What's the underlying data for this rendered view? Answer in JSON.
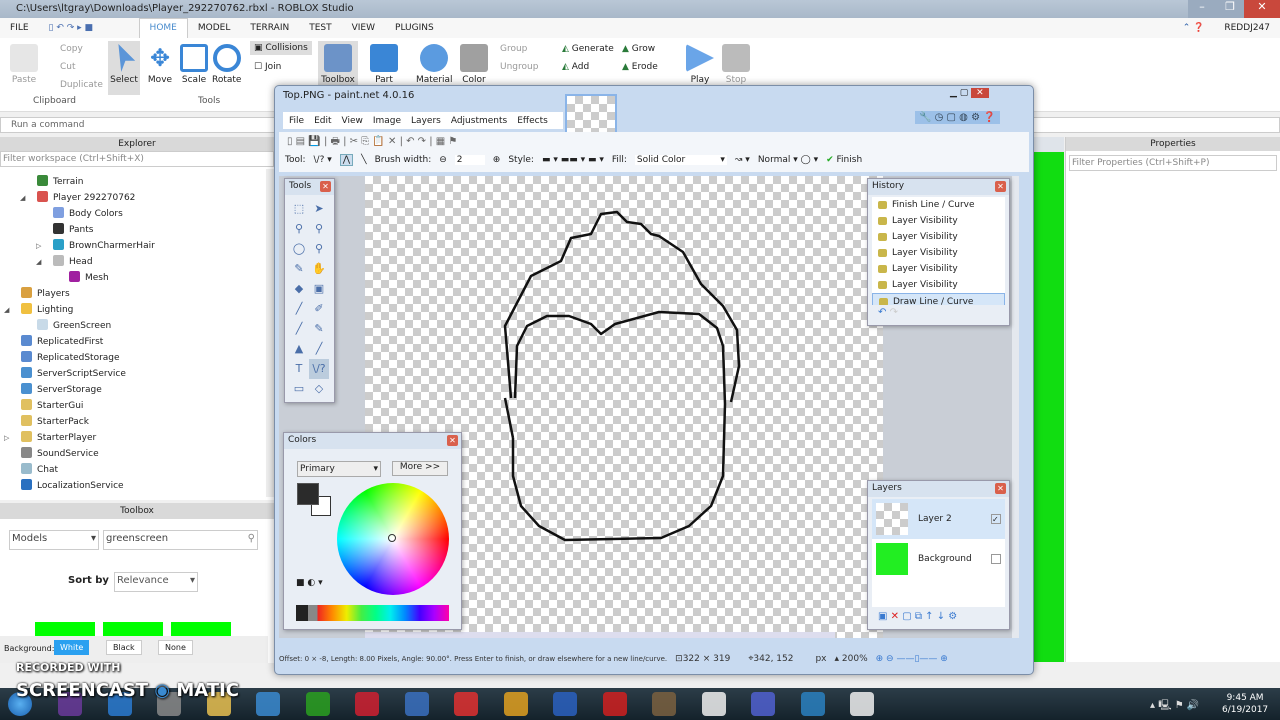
{
  "studio": {
    "title": "C:\\Users\\ltgray\\Downloads\\Player_292270762.rbxl - ROBLOX Studio",
    "menu_tabs": [
      "FILE",
      "HOME",
      "MODEL",
      "TERRAIN",
      "TEST",
      "VIEW",
      "PLUGINS"
    ],
    "active_tab": "HOME",
    "user": "REDDJ247",
    "ribbon": {
      "paste": "Paste",
      "copy": "Copy",
      "cut": "Cut",
      "duplicate": "Duplicate",
      "clipboard": "Clipboard",
      "select": "Select",
      "move": "Move",
      "scale": "Scale",
      "rotate": "Rotate",
      "tools": "Tools",
      "collisions": "Collisions",
      "join": "Join",
      "toolbox": "Toolbox",
      "part": "Part",
      "material": "Material",
      "color": "Color",
      "group": "Group",
      "ungroup": "Ungroup",
      "generate": "Generate",
      "add": "Add",
      "grow": "Grow",
      "erode": "Erode",
      "play": "Play",
      "stop": "Stop"
    },
    "command_placeholder": "Run a command",
    "explorer": {
      "title": "Explorer",
      "filter": "Filter workspace (Ctrl+Shift+X)",
      "items": [
        {
          "label": "Terrain",
          "indent": 2,
          "color": "#3a8a3a"
        },
        {
          "label": "Player 292270762",
          "indent": 2,
          "color": "#d9534f",
          "expander": "open"
        },
        {
          "label": "Body Colors",
          "indent": 3,
          "color": "#7f9fe0"
        },
        {
          "label": "Pants",
          "indent": 3,
          "color": "#333"
        },
        {
          "label": "BrownCharmerHair",
          "indent": 3,
          "color": "#2aa0c8",
          "expander": "closed"
        },
        {
          "label": "Head",
          "indent": 3,
          "color": "#bbb",
          "expander": "open"
        },
        {
          "label": "Mesh",
          "indent": 4,
          "color": "#a020a0"
        },
        {
          "label": "Players",
          "indent": 1,
          "color": "#d9a040"
        },
        {
          "label": "Lighting",
          "indent": 1,
          "color": "#f0c040",
          "expander": "open"
        },
        {
          "label": "GreenScreen",
          "indent": 2,
          "color": "#c8dae8"
        },
        {
          "label": "ReplicatedFirst",
          "indent": 1,
          "color": "#5a8ad0"
        },
        {
          "label": "ReplicatedStorage",
          "indent": 1,
          "color": "#5a8ad0"
        },
        {
          "label": "ServerScriptService",
          "indent": 1,
          "color": "#4a90d0"
        },
        {
          "label": "ServerStorage",
          "indent": 1,
          "color": "#4a90d0"
        },
        {
          "label": "StarterGui",
          "indent": 1,
          "color": "#e0c060"
        },
        {
          "label": "StarterPack",
          "indent": 1,
          "color": "#e0c060"
        },
        {
          "label": "StarterPlayer",
          "indent": 1,
          "color": "#e0c060",
          "expander": "closed"
        },
        {
          "label": "SoundService",
          "indent": 1,
          "color": "#888"
        },
        {
          "label": "Chat",
          "indent": 1,
          "color": "#9bc"
        },
        {
          "label": "LocalizationService",
          "indent": 1,
          "color": "#2a70c0"
        }
      ]
    },
    "toolbox": {
      "title": "Toolbox",
      "category": "Models",
      "search": "greenscreen",
      "sort_label": "Sort by",
      "sort_value": "Relevance",
      "background_label": "Background:",
      "bg_options": [
        "White",
        "Black",
        "None"
      ],
      "bg_selected": "White"
    },
    "properties": {
      "title": "Properties",
      "filter": "Filter Properties (Ctrl+Shift+P)"
    }
  },
  "paintnet": {
    "title": "Top.PNG - paint.net 4.0.16",
    "menu": [
      "File",
      "Edit",
      "View",
      "Image",
      "Layers",
      "Adjustments",
      "Effects"
    ],
    "tool_label": "Tool:",
    "brush_label": "Brush width:",
    "brush_value": "2",
    "style_label": "Style:",
    "fill_label": "Fill:",
    "fill_value": "Solid Color",
    "blend_value": "Normal",
    "finish": "Finish",
    "tools_title": "Tools",
    "colors": {
      "title": "Colors",
      "mode": "Primary",
      "more": "More >>",
      "primary": "#2b2b2b",
      "secondary": "#ffffff"
    },
    "history": {
      "title": "History",
      "items": [
        "Finish Line / Curve",
        "Layer Visibility",
        "Layer Visibility",
        "Layer Visibility",
        "Layer Visibility",
        "Layer Visibility",
        "Draw Line / Curve"
      ],
      "selected": "Draw Line / Curve"
    },
    "layers": {
      "title": "Layers",
      "items": [
        {
          "name": "Layer 2",
          "visible": true
        },
        {
          "name": "Background",
          "visible": false
        }
      ]
    },
    "status": {
      "hint": "Offset: 0 × -8, Length: 8.00 Pixels, Angle: 90.00°. Press Enter to finish, or draw elsewhere for a new line/curve.",
      "size": "322 × 319",
      "cursor": "342, 152",
      "unit": "px",
      "zoom": "200%"
    }
  },
  "watermark": {
    "line1": "RECORDED WITH",
    "line2": "SCREENCAST",
    "line3": "MATIC"
  },
  "taskbar": {
    "time": "9:45 AM",
    "date": "6/19/2017"
  }
}
